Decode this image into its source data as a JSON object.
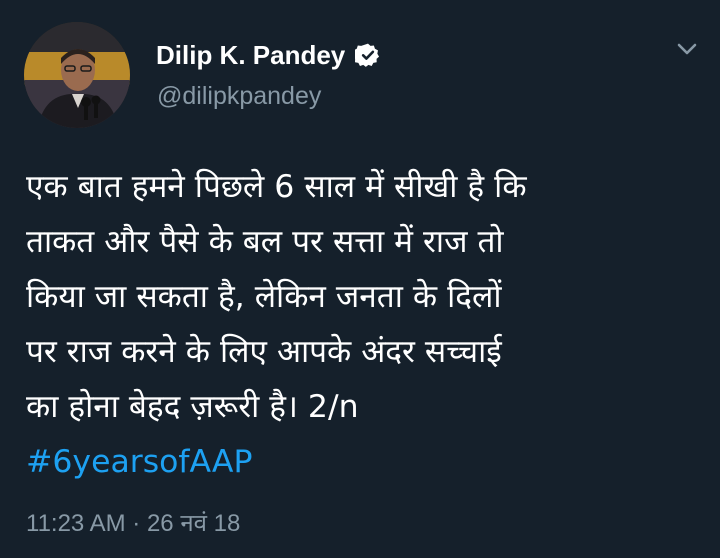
{
  "author": {
    "display_name": "Dilip K. Pandey",
    "handle": "@dilipkpandey",
    "verified": true,
    "avatar_icon": "profile-photo"
  },
  "tweet": {
    "lines": [
      "एक बात हमने पिछले 6 साल में सीखी है कि",
      "ताकत और पैसे के बल पर सत्ता में राज तो",
      "किया जा सकता है, लेकिन जनता के दिलों",
      "पर राज करने के लिए आपके अंदर सच्चाई",
      "का होना बेहद ज़रूरी है। 2/n"
    ],
    "hashtag": "#6yearsofAAP",
    "timestamp": "11:23 AM · 26 नवं 18"
  },
  "colors": {
    "background": "#15202b",
    "text": "#ffffff",
    "secondary_text": "#8899a6",
    "link": "#1da1f2"
  },
  "icons": {
    "verified": "verified-badge-icon",
    "menu": "chevron-down-icon"
  }
}
